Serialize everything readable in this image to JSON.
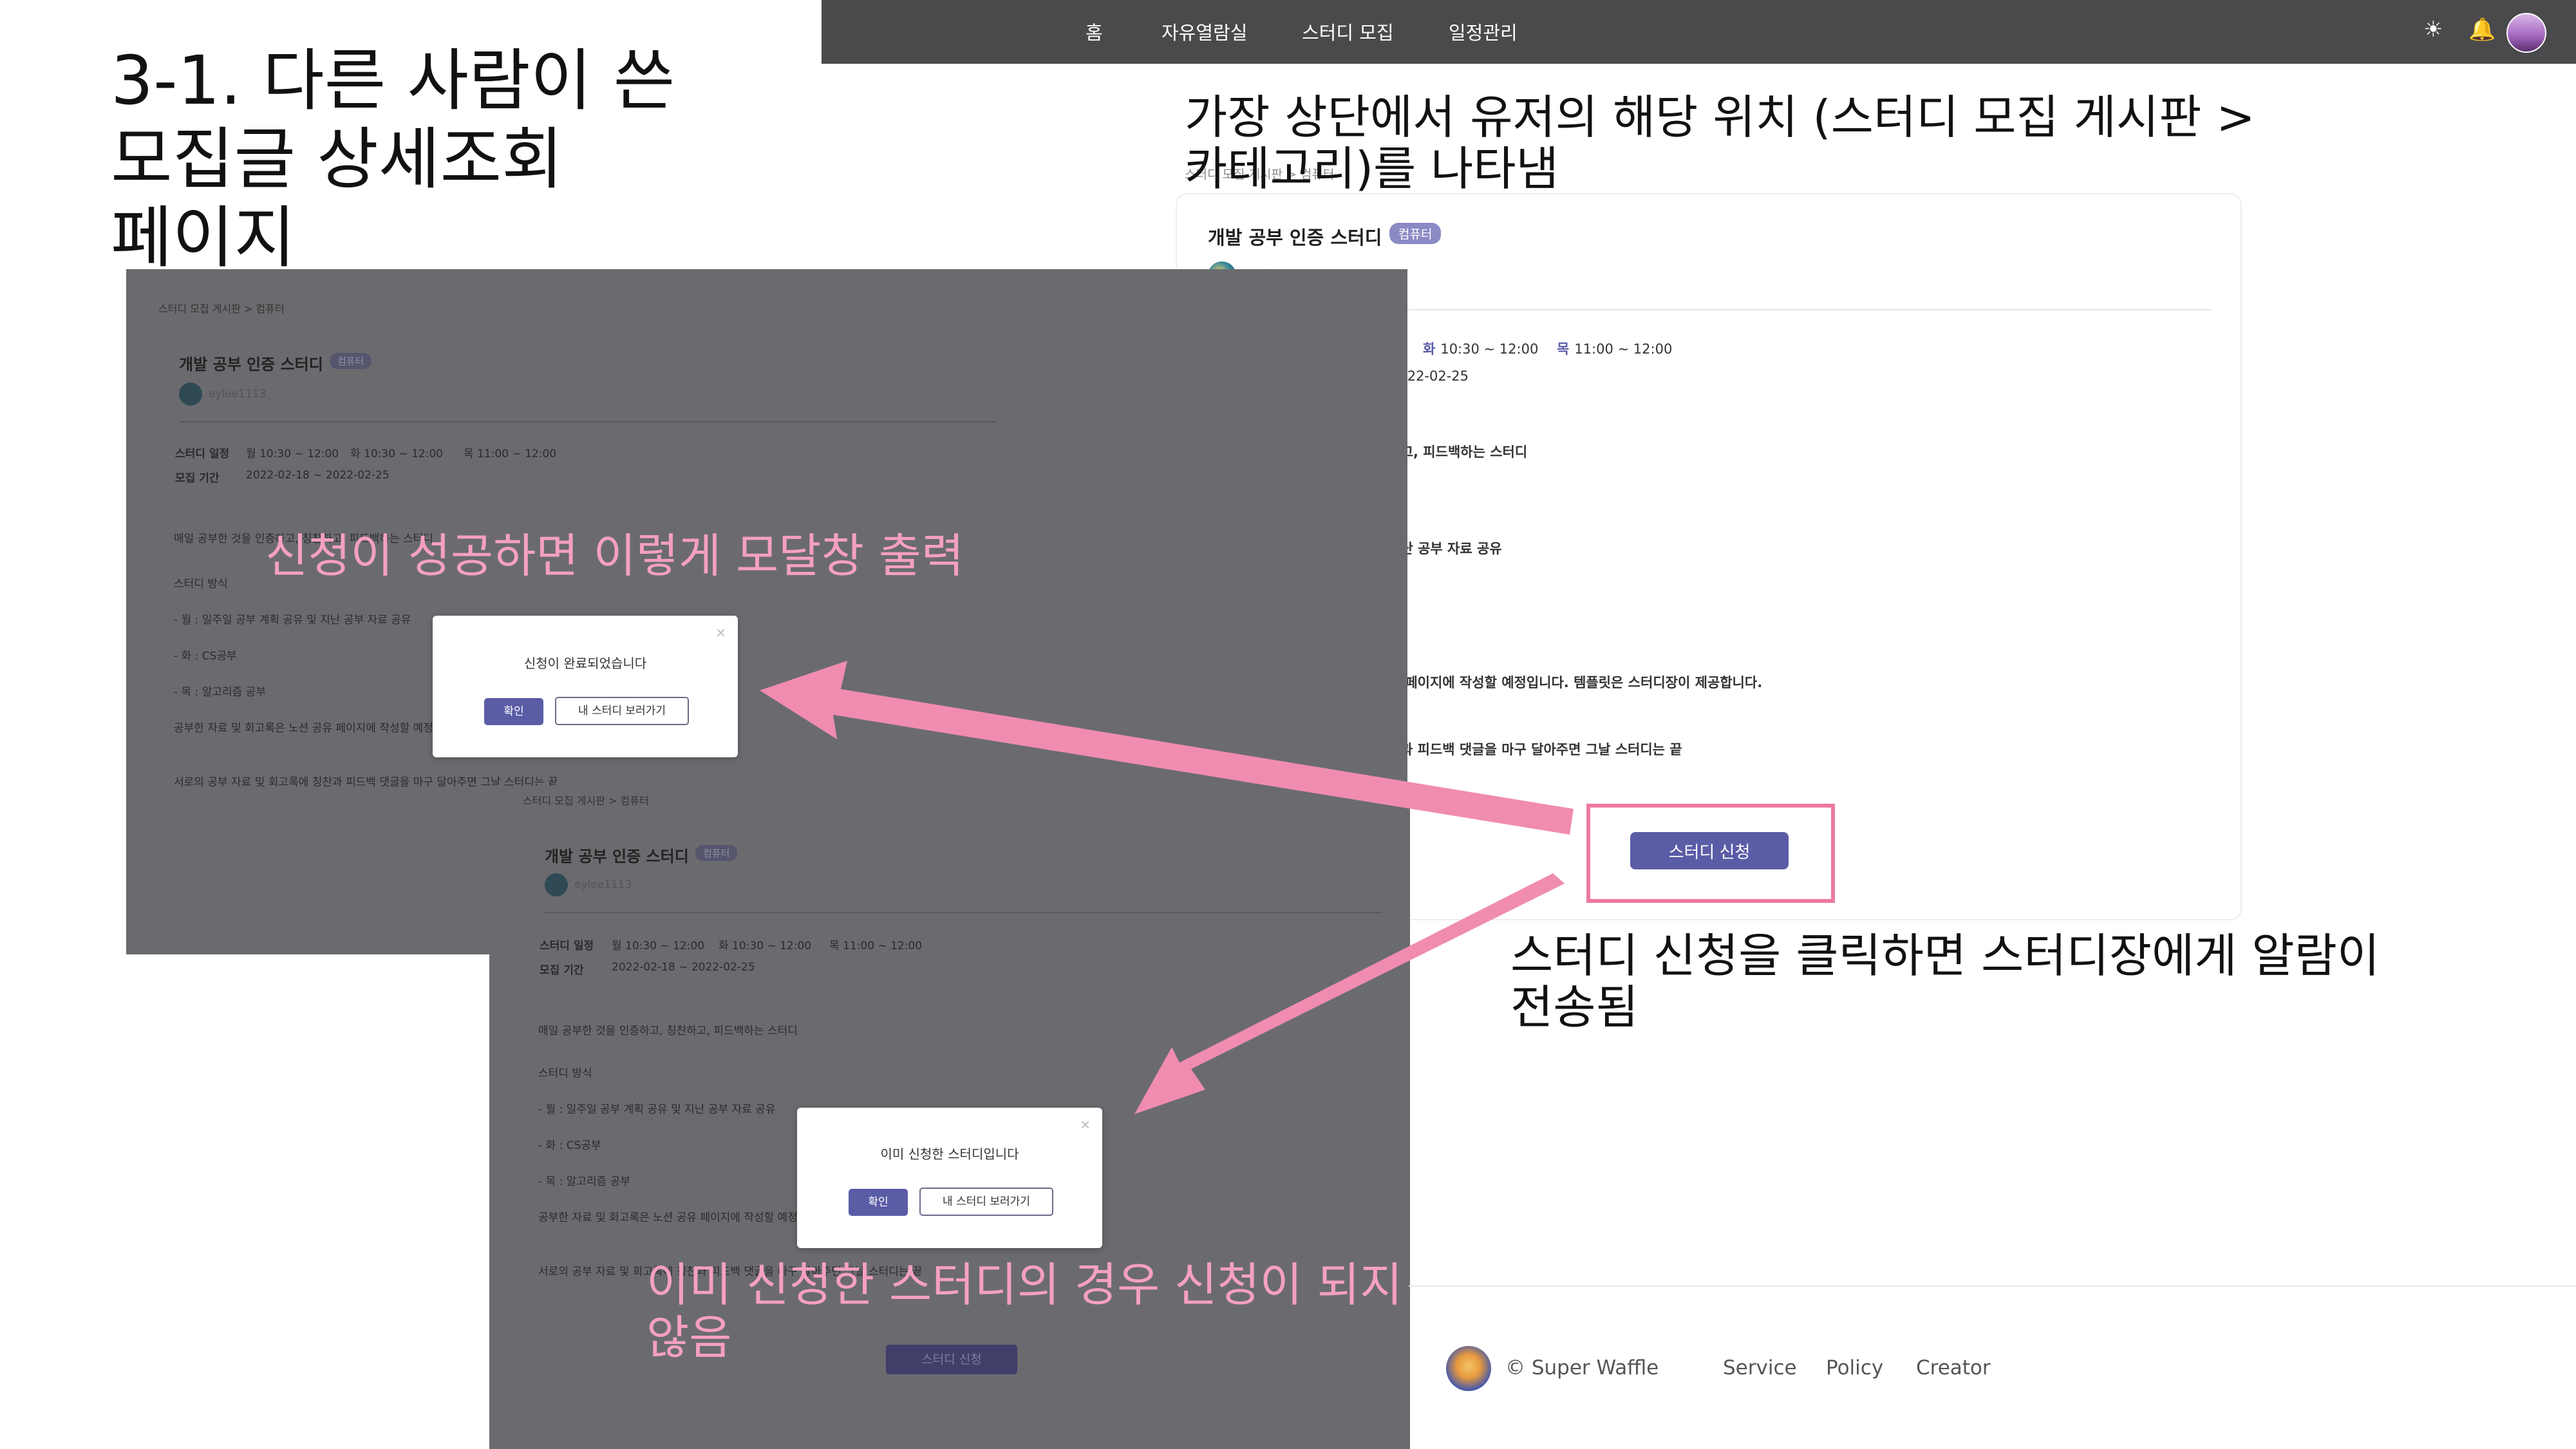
{
  "slide": {
    "title_lines": [
      "3-1. 다른 사람이 쓴",
      "모집글 상세조회",
      "페이지"
    ],
    "note_top_lines": [
      "가장 상단에서 유저의 해당 위치 (스터디 모집 게시판 >",
      "카테고리)를 나타냄"
    ],
    "note_apply_lines": [
      "스터디 신청을 클릭하면 스터디장에게 알람이",
      "전송됨"
    ],
    "note_success": "신청이 성공하면 이렇게 모달창 출력",
    "note_already_lines": [
      "이미 신청한 스터디의 경우 신청이 되지",
      "않음"
    ]
  },
  "nav": {
    "items": [
      "홈",
      "자유열람실",
      "스터디 모집",
      "일정관리"
    ],
    "icons": [
      "sun-icon",
      "bell-icon",
      "avatar"
    ]
  },
  "detail": {
    "breadcrumb": "스터디 모집 게시판 > 컴퓨터",
    "title": "개발 공부 인증 스터디",
    "category_badge": "컴퓨터",
    "author": "eylee1113",
    "schedule_label": "스터디 일정",
    "schedule": [
      {
        "day": "월",
        "time": "10:30 ~ 12:00"
      },
      {
        "day": "화",
        "time": "10:30 ~ 12:00"
      },
      {
        "day": "목",
        "time": "11:00 ~ 12:00"
      }
    ],
    "period_label": "모집 기간",
    "period": "2022-02-18 ~ 2022-02-25",
    "body": [
      "매일 공부한 것을 인증하고, 칭찬하고, 피드백하는 스터디",
      "스터디 방식",
      "- 월 : 일주일 공부 계획 공유 및 지난 공부 자료 공유",
      "- 화 : CS공부",
      "- 목 : 알고리즘 공부",
      "공부한 자료 및 회고록은 노션 공유 페이지에 작성할 예정입니다. 템플릿은 스터디장이 제공합니다.",
      "서로의 공부 자료 및 회고록에 칭찬과 피드백 댓글을 마구 달아주면 그날 스터디는 끝"
    ],
    "apply_button": "스터디 신청"
  },
  "modal_success": {
    "message": "신청이 완료되었습니다",
    "ok": "확인",
    "my_study": "내 스터디 보러가기",
    "close": "×"
  },
  "modal_already": {
    "message": "이미 신청한 스터디입니다",
    "ok": "확인",
    "my_study": "내 스터디 보러가기",
    "close": "×"
  },
  "footer": {
    "brand": "© Super Waffle",
    "links": [
      "Service",
      "Policy",
      "Creator"
    ]
  },
  "colors": {
    "nav_bg": "#4a4a4d",
    "accent": "#5b5ca6",
    "badge": "#8b8ac4",
    "annotation_pink": "#f5a0bf",
    "arrow_pink": "#f08cb0",
    "highlight": "#ec7aa4"
  }
}
